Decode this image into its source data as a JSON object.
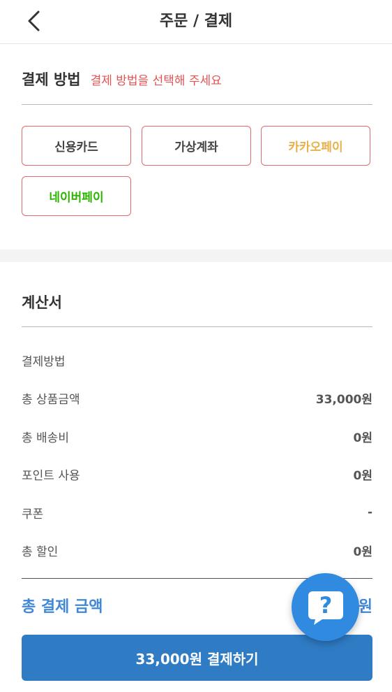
{
  "header": {
    "title": "주문 / 결제"
  },
  "payment_method": {
    "title": "결제 방법",
    "hint": "결제 방법을 선택해 주세요",
    "options": [
      {
        "label": "신용카드",
        "color": "#444444"
      },
      {
        "label": "가상계좌",
        "color": "#444444"
      },
      {
        "label": "카카오페이",
        "color": "#e8b04a"
      },
      {
        "label": "네이버페이",
        "color": "#2db400"
      }
    ]
  },
  "bill": {
    "title": "계산서",
    "rows": [
      {
        "label": "결제방법",
        "value": ""
      },
      {
        "label": "총 상품금액",
        "value": "33,000원"
      },
      {
        "label": "총 배송비",
        "value": "0원"
      },
      {
        "label": "포인트 사용",
        "value": "0원"
      },
      {
        "label": "쿠폰",
        "value": "-"
      },
      {
        "label": "총 할인",
        "value": "0원"
      }
    ],
    "total_label": "총 결제 금액",
    "total_value": "원"
  },
  "cta": {
    "label": "33,000원 결제하기"
  },
  "help": {
    "symbol": "?"
  },
  "colors": {
    "accent": "#2f7bc4",
    "total": "#3f88d9",
    "hint": "#e55353",
    "border": "#e36a6a"
  }
}
